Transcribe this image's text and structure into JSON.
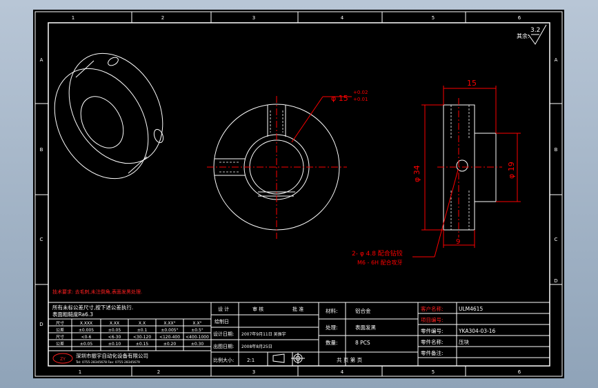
{
  "drawing": {
    "zone_columns": [
      "1",
      "2",
      "3",
      "4",
      "5",
      "6"
    ],
    "zone_rows": [
      "A",
      "B",
      "C",
      "D"
    ],
    "roughness_label": "其余:",
    "roughness_value": "3.2",
    "dim_hole_dia": "φ 15",
    "dim_hole_tol_upper": "+0.02",
    "dim_hole_tol_lower": "+0.01",
    "dim_width": "15",
    "dim_outer_dia": "φ 34",
    "dim_step_dia": "φ 19",
    "dim_bottom": "9",
    "callout_line1": "2- φ  4.8 配合钻铰",
    "callout_line2": "M6 - 6H 配合攻牙",
    "tech_note_red": "技术要求: 去毛刺,未注倒角,表面发黑处理.",
    "general_note_1": "所有未标公差尺寸,按下述公差执行.",
    "general_note_2": "表面粗糙度Ra6.3"
  },
  "tolerance_table": {
    "headers": [
      "尺寸",
      "X.XXX",
      "X.XX",
      "X.X",
      "X.XX°",
      "X.X°"
    ],
    "rows": [
      [
        "公差",
        "±0.005",
        "±0.05",
        "±0.1",
        "±0.005°",
        "±0.5°"
      ],
      [
        "尺寸",
        "<0-6",
        "<6-30",
        "<30-120",
        "<120-400",
        "<400-1000"
      ],
      [
        "公差",
        "±0.05",
        "±0.10",
        "±0.15",
        "±0.20",
        "±0.30"
      ]
    ]
  },
  "title_block": {
    "design": "设 计",
    "check": "审 核",
    "approve": "批 准",
    "drawn_by": "绘制日",
    "designer_label": "设计日期:",
    "designer_value": "2007年9月11日 吴振宇",
    "date_label": "出图日期:",
    "date_value": "2008年8月25日",
    "scale_label": "比例大小:",
    "scale_value": "2:1",
    "material_label": "材料:",
    "material_value": "铝合金",
    "treatment_label": "处理:",
    "treatment_value": "表面发黑",
    "qty_label": "数量:",
    "qty_value": "8  PCS",
    "sheet_label": "共 页 第 页",
    "customer_label": "客户名称:",
    "customer_value": "ULM4615",
    "project_label": "项目编号:",
    "drawing_no_label": "零件编号:",
    "drawing_no_value": "YKA304-03-16",
    "part_name_label": "零件名称:",
    "part_name_value": "压块",
    "remark_label": "零件备注:",
    "company_name": "深圳市振宇自动化设备有限公司",
    "company_sub": "Tel: 0755-28345678 Fax: 0755-28345679",
    "logo_text": "ZY"
  },
  "colors": {
    "line": "#ffffff",
    "center": "#ff0000",
    "dim": "#ff0000",
    "note": "#ff2020",
    "canvas": "#000000",
    "text": "#ffffff"
  }
}
